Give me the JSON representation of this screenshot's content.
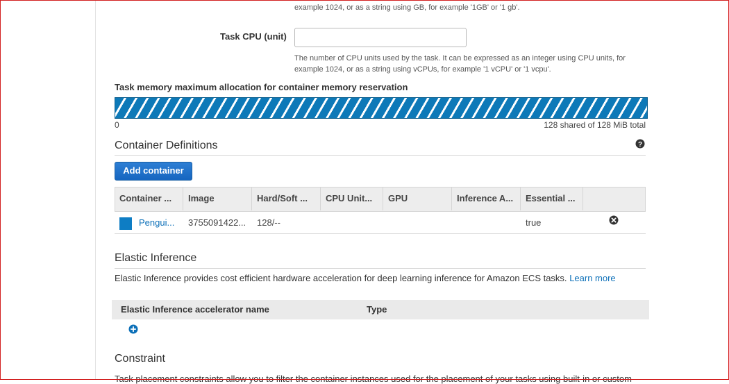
{
  "memory_help_tail": "example 1024, or as a string using GB, for example '1GB' or '1 gb'.",
  "task_cpu": {
    "label": "Task CPU (unit)",
    "value": "",
    "help_line1": "The number of CPU units used by the task. It can be expressed as an integer using CPU units, for",
    "help_line2": "example 1024, or as a string using vCPUs, for example '1 vCPU' or '1 vcpu'."
  },
  "memory_allocation": {
    "title": "Task memory maximum allocation for container memory reservation",
    "min_label": "0",
    "total_label": "128 shared of 128 MiB total",
    "shared_mib": 128,
    "total_mib": 128,
    "bar_color": "#0d79b8"
  },
  "container_definitions": {
    "heading": "Container Definitions",
    "help_icon": "question-circle-icon",
    "add_button": "Add container",
    "columns": [
      "Container ...",
      "Image",
      "Hard/Soft ...",
      "CPU Unit...",
      "GPU",
      "Inference A...",
      "Essential ..."
    ],
    "rows": [
      {
        "name": "Pengui...",
        "image": "3755091422...",
        "hard_soft": "128/--",
        "cpu": "",
        "gpu": "",
        "inference": "",
        "essential": "true",
        "remove_icon": "remove-circle-icon",
        "color": "#0e7dc4"
      }
    ]
  },
  "elastic_inference": {
    "heading": "Elastic Inference",
    "description": "Elastic Inference provides cost efficient hardware acceleration for deep learning inference for Amazon ECS tasks.",
    "learn_more": "Learn more",
    "columns": [
      "Elastic Inference accelerator name",
      "Type"
    ],
    "add_icon": "plus-circle-icon"
  },
  "constraint": {
    "heading": "Constraint",
    "description": "Task placement constraints allow you to filter the container instances used for the placement of your tasks using built-in or custom"
  }
}
